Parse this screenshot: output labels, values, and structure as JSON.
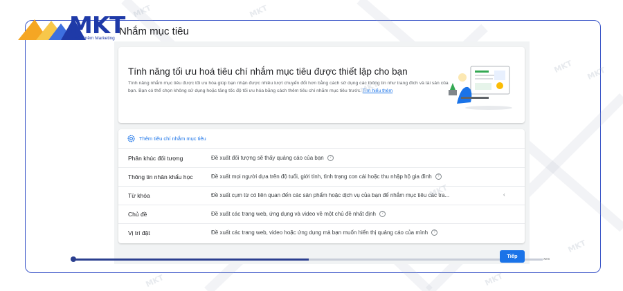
{
  "logo": {
    "brand": "MKT",
    "tagline": "Phần mềm Marketing"
  },
  "page": {
    "title": "Nhắm mục tiêu"
  },
  "info_card": {
    "title": "Tính năng tối ưu hoá tiêu chí nhắm mục tiêu được thiết lập cho bạn",
    "description": "Tính năng nhắm mục tiêu được tối ưu hóa giúp bạn nhận được nhiều lượt chuyển đổi hơn bằng cách sử dụng các thông tin như trang đích và tài sản của bạn. Bạn có thể chọn không sử dụng hoặc tăng tốc độ tối ưu hóa bằng cách thêm tiêu chí nhắm mục tiêu trước.",
    "link": "Tìm hiểu thêm"
  },
  "targeting": {
    "add_label": "Thêm tiêu chí nhắm mục tiêu",
    "rows": [
      {
        "label": "Phân khúc đối tượng",
        "desc": "Đề xuất đối tượng sẽ thấy quảng cáo của bạn"
      },
      {
        "label": "Thông tin nhân khẩu học",
        "desc": "Đề xuất mọi người dựa trên độ tuổi, giới tính, tình trạng con cái hoặc thu nhập hộ gia đình"
      },
      {
        "label": "Từ khóa",
        "desc": "Đề xuất cụm từ có liên quan đến các sản phẩm hoặc dịch vụ của bạn để nhắm mục tiêu các tra..."
      },
      {
        "label": "Chủ đề",
        "desc": "Đề xuất các trang web, ứng dụng và video về một chủ đề nhất định"
      },
      {
        "label": "Vị trí đặt",
        "desc": "Đề xuất các trang web, video hoặc ứng dụng mà bạn muốn hiển thị quảng cáo của mình"
      }
    ]
  },
  "footer": {
    "next_label": "Tiếp",
    "end_label": "Xem",
    "progress": 0.5
  },
  "watermark": {
    "text": "MKT"
  },
  "colors": {
    "brand": "#1f3aa8",
    "link": "#1a73e8",
    "frame": "#3c57c8"
  },
  "icons": {
    "add": "gear-icon",
    "help": "help-icon",
    "expand": "chevron-left-icon"
  }
}
